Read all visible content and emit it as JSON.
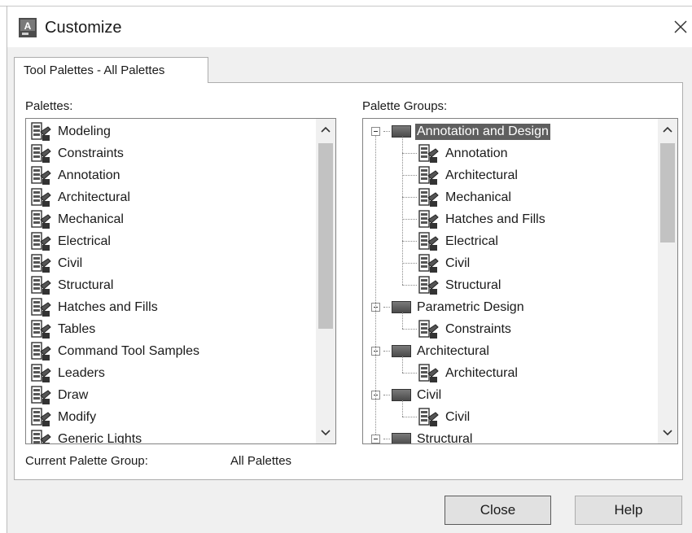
{
  "window": {
    "title": "Customize",
    "app_icon_letter": "A",
    "close_glyph": "✕"
  },
  "tab": {
    "label": "Tool Palettes - All Palettes"
  },
  "palettes": {
    "label": "Palettes:",
    "items": [
      "Modeling",
      "Constraints",
      "Annotation",
      "Architectural",
      "Mechanical",
      "Electrical",
      "Civil",
      "Structural",
      "Hatches and Fills",
      "Tables",
      "Command Tool Samples",
      "Leaders",
      "Draw",
      "Modify",
      "Generic Lights"
    ]
  },
  "palette_groups": {
    "label": "Palette Groups:",
    "tree": [
      {
        "kind": "group",
        "label": "Annotation and Design",
        "selected": true
      },
      {
        "kind": "child",
        "label": "Annotation"
      },
      {
        "kind": "child",
        "label": "Architectural"
      },
      {
        "kind": "child",
        "label": "Mechanical"
      },
      {
        "kind": "child",
        "label": "Hatches and Fills"
      },
      {
        "kind": "child",
        "label": "Electrical"
      },
      {
        "kind": "child",
        "label": "Civil"
      },
      {
        "kind": "child",
        "label": "Structural"
      },
      {
        "kind": "group",
        "label": "Parametric Design"
      },
      {
        "kind": "child",
        "label": "Constraints"
      },
      {
        "kind": "group",
        "label": "Architectural"
      },
      {
        "kind": "child",
        "label": "Architectural"
      },
      {
        "kind": "group",
        "label": "Civil"
      },
      {
        "kind": "child",
        "label": "Civil"
      },
      {
        "kind": "group",
        "label": "Structural"
      }
    ]
  },
  "current_group": {
    "label": "Current Palette Group:",
    "value": "All Palettes"
  },
  "buttons": {
    "close": "Close",
    "help": "Help"
  },
  "colors": {
    "selection_bg": "#5f5f5f",
    "dialog_bg": "#f0f0f0",
    "button_bg": "#e1e1e1"
  },
  "icons": {
    "palette_item": "tool-palette-icon",
    "group_item": "palette-group-icon",
    "expander": "collapse-minus-icon"
  }
}
